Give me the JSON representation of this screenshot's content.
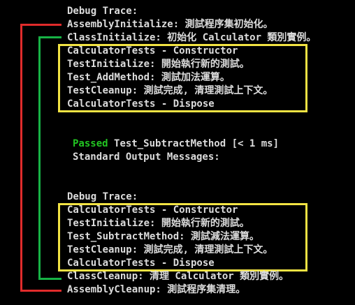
{
  "output": {
    "lines": [
      "Debug Trace:",
      "AssemblyInitialize: 測試程序集初始化。",
      "ClassInitialize: 初始化 Calculator 類別實例。",
      "CalculatorTests - Constructor",
      "TestInitialize: 開始執行新的測試。",
      "Test_AddMethod: 測試加法運算。",
      "TestCleanup: 測試完成, 清理測試上下文。",
      "CalculatorTests - Dispose",
      "Test_SubtractMethod [< 1 ms]",
      "Standard Output Messages:",
      "Debug Trace:",
      "CalculatorTests - Constructor",
      "TestInitialize: 開始執行新的測試。",
      "Test_SubtractMethod: 測試減法運算。",
      "TestCleanup: 測試完成, 清理測試上下文。",
      "CalculatorTests - Dispose",
      "ClassCleanup: 清理 Calculator 類別實例。",
      "AssemblyCleanup: 測試程序集清理。"
    ],
    "passed_label": "Passed"
  },
  "colors": {
    "background": "#000000",
    "text": "#dcdcdc",
    "passed": "#22c522",
    "assembly_bracket": "#e02b2b",
    "class_bracket": "#17b245",
    "test_box": "#f2e343"
  }
}
